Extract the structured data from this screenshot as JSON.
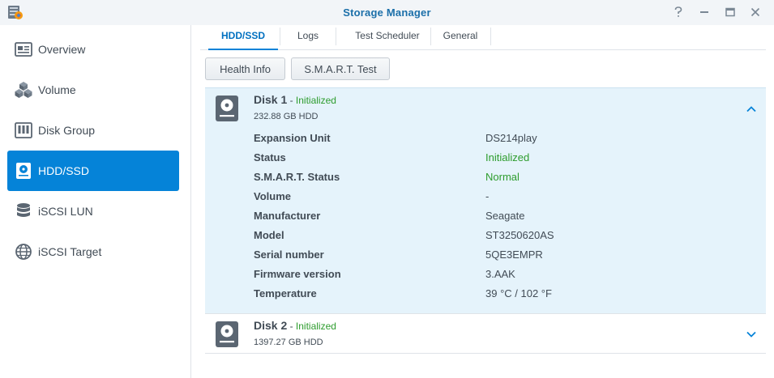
{
  "window": {
    "title": "Storage Manager",
    "app_icon": "storage-manager-app-icon",
    "controls": [
      "help-icon",
      "minimize-icon",
      "maximize-icon",
      "close-icon"
    ]
  },
  "sidebar": {
    "items": [
      {
        "label": "Overview",
        "icon": "overview-icon",
        "active": false
      },
      {
        "label": "Volume",
        "icon": "volume-icon",
        "active": false
      },
      {
        "label": "Disk Group",
        "icon": "disk-group-icon",
        "active": false
      },
      {
        "label": "HDD/SSD",
        "icon": "hdd-icon",
        "active": true
      },
      {
        "label": "iSCSI LUN",
        "icon": "iscsi-lun-icon",
        "active": false
      },
      {
        "label": "iSCSI Target",
        "icon": "iscsi-target-icon",
        "active": false
      }
    ]
  },
  "tabs": [
    {
      "label": "HDD/SSD",
      "active": true
    },
    {
      "label": "Logs",
      "active": false
    },
    {
      "label": "Test Scheduler",
      "active": false
    },
    {
      "label": "General",
      "active": false
    }
  ],
  "toolbar": {
    "health_info_label": "Health Info",
    "smart_test_label": "S.M.A.R.T. Test"
  },
  "disks": [
    {
      "name": "Disk 1",
      "dash": " - ",
      "state": "Initialized",
      "size": "232.88 GB HDD",
      "expanded": true,
      "details": [
        {
          "key": "Expansion Unit",
          "value": "DS214play"
        },
        {
          "key": "Status",
          "value": "Initialized"
        },
        {
          "key": "S.M.A.R.T. Status",
          "value": "Normal"
        },
        {
          "key": "Volume",
          "value": "-"
        },
        {
          "key": "Manufacturer",
          "value": "Seagate"
        },
        {
          "key": "Model",
          "value": "ST3250620AS"
        },
        {
          "key": "Serial number",
          "value": "5QE3EMPR"
        },
        {
          "key": "Firmware version",
          "value": "3.AAK"
        },
        {
          "key": "Temperature",
          "value": "39 °C / 102 °F"
        }
      ]
    },
    {
      "name": "Disk 2",
      "dash": " - ",
      "state": "Initialized",
      "size": "1397.27 GB HDD",
      "expanded": false
    }
  ],
  "colors": {
    "accent": "#0583d8",
    "title": "#1b6fa9",
    "status_green": "#2d9c2d",
    "expanded_bg": "#e5f3fb"
  }
}
